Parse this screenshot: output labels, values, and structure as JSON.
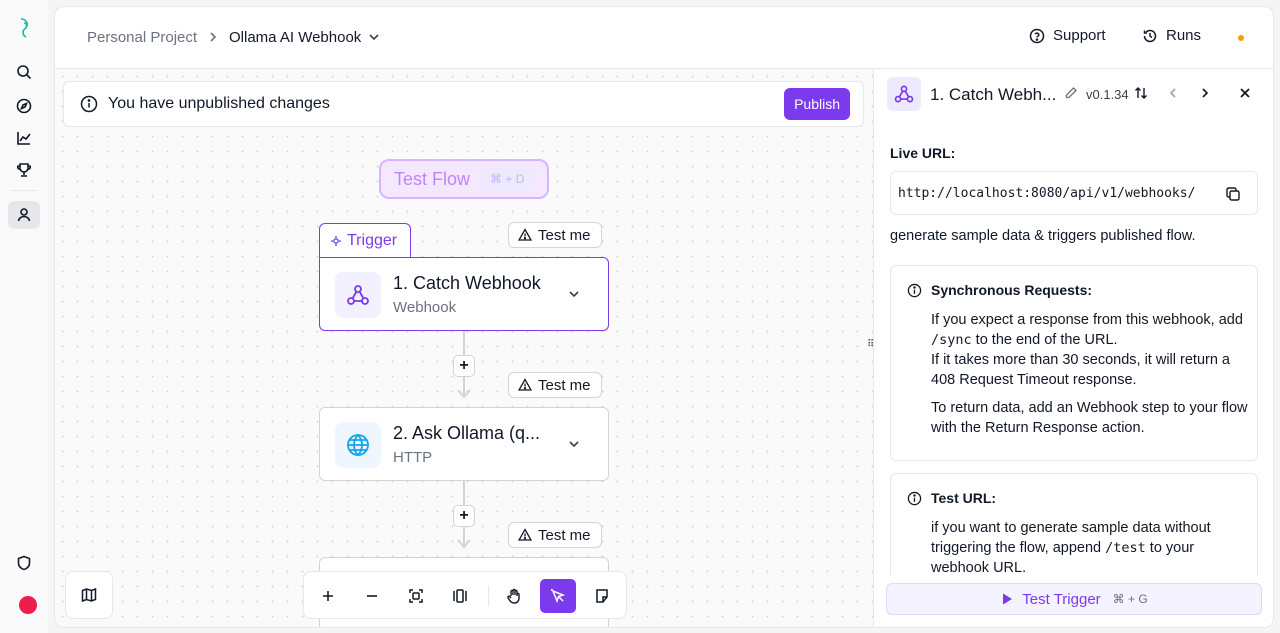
{
  "breadcrumb": {
    "project": "Personal Project",
    "flow": "Ollama AI Webhook"
  },
  "header": {
    "support_label": "Support",
    "runs_label": "Runs",
    "status_color": "#f59e0b"
  },
  "banner": {
    "message": "You have unpublished changes",
    "publish_label": "Publish"
  },
  "test_flow": {
    "label": "Test Flow",
    "shortcut": "⌘ + D"
  },
  "trigger_tag": "Trigger",
  "steps": [
    {
      "title": "1. Catch Webhook",
      "subtitle": "Webhook",
      "icon": "webhook-icon",
      "test_label": "Test me",
      "selected": true
    },
    {
      "title": "2. Ask Ollama (q...",
      "subtitle": "HTTP",
      "icon": "globe-icon",
      "test_label": "Test me",
      "selected": false
    },
    {
      "title": "",
      "subtitle": "",
      "icon": "",
      "test_label": "Test me",
      "selected": false
    }
  ],
  "panel": {
    "title": "1. Catch Webh...",
    "version": "v0.1.34",
    "live_url_label": "Live URL:",
    "live_url": "http://localhost:8080/api/v1/webhooks/",
    "description": "generate sample data & triggers published flow.",
    "sync_card": {
      "title": "Synchronous Requests:",
      "line1a": "If you expect a response from this webhook, add ",
      "line1code": "/sync",
      "line1b": " to the end of the URL.",
      "line2": "If it takes more than 30 seconds, it will return a 408 Request Timeout response.",
      "line3": "To return data, add an Webhook step to your flow with the Return Response action."
    },
    "test_card": {
      "title": "Test URL:",
      "line1a": "if you want to generate sample data without triggering the flow, append ",
      "line1code": "/test",
      "line1b": " to your webhook URL."
    },
    "test_trigger_label": "Test Trigger",
    "test_trigger_shortcut": "⌘ + G"
  },
  "colors": {
    "accent": "#7c3aed",
    "avatar": "#ef1d4b"
  }
}
